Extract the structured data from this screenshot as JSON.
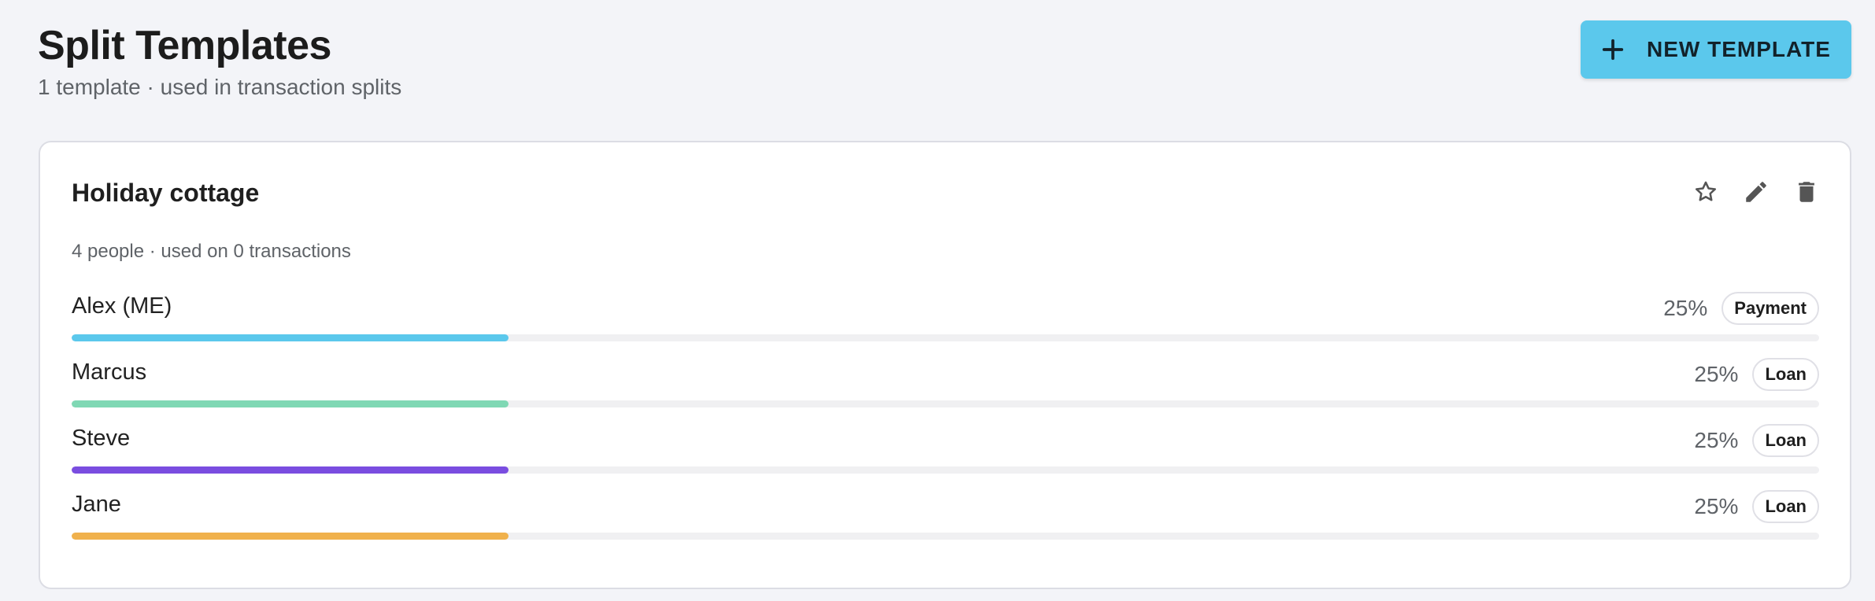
{
  "header": {
    "title": "Split Templates",
    "subtitle": "1 template · used in transaction splits",
    "new_button_label": "NEW TEMPLATE"
  },
  "icons": {
    "new_button": "plus-icon",
    "favorite": "star-outline-icon",
    "edit": "pencil-icon",
    "delete": "trash-icon"
  },
  "template": {
    "name": "Holiday cottage",
    "meta": "4 people · used on 0 transactions",
    "members": [
      {
        "name": "Alex (ME)",
        "percent_label": "25%",
        "share": 0.25,
        "type": "Payment",
        "color": "#5bc8ec"
      },
      {
        "name": "Marcus",
        "percent_label": "25%",
        "share": 0.25,
        "type": "Loan",
        "color": "#7fd8b4"
      },
      {
        "name": "Steve",
        "percent_label": "25%",
        "share": 0.25,
        "type": "Loan",
        "color": "#7a4de0"
      },
      {
        "name": "Jane",
        "percent_label": "25%",
        "share": 0.25,
        "type": "Loan",
        "color": "#f0b14c"
      }
    ]
  },
  "colors": {
    "accent": "#5bc8ec",
    "background": "#f3f4f8"
  }
}
